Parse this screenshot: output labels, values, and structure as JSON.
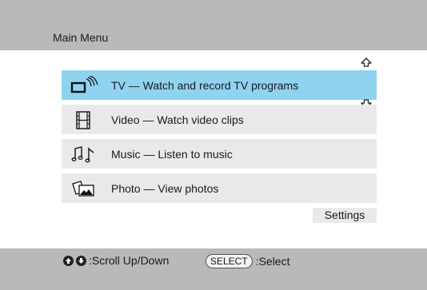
{
  "menu": {
    "title": "Main Menu",
    "items": [
      {
        "name": "TV",
        "dash": " — ",
        "desc": "Watch and record TV programs",
        "icon": "tv-icon",
        "selected": true
      },
      {
        "name": "Video",
        "dash": " — ",
        "desc": "Watch video clips",
        "icon": "film-icon",
        "selected": false
      },
      {
        "name": "Music",
        "dash": " — ",
        "desc": "Listen to music",
        "icon": "music-note-icon",
        "selected": false
      },
      {
        "name": "Photo",
        "dash": " — ",
        "desc": "View photos",
        "icon": "photo-icon",
        "selected": false
      }
    ],
    "settings_label": "Settings"
  },
  "footer": {
    "scroll_hint": ":Scroll Up/Down",
    "select_key": "SELECT",
    "select_hint": ":Select"
  },
  "colors": {
    "selected_bg": "#8fd3f0",
    "item_bg": "#e9e9e9",
    "bar_bg": "#b9b9b9"
  }
}
